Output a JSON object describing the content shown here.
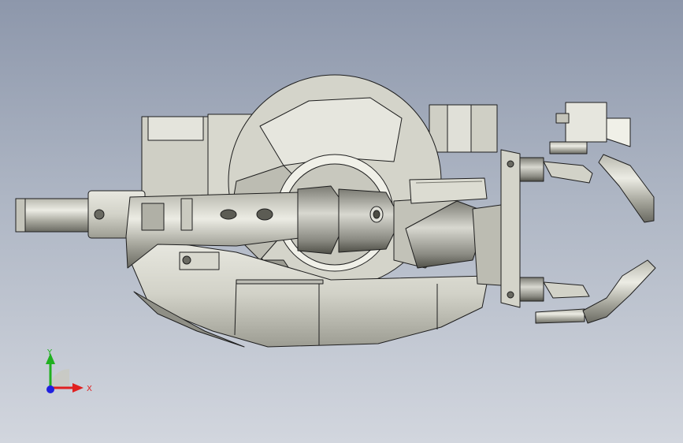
{
  "viewport": {
    "background_top": "#8d97ab",
    "background_bottom": "#d2d6de"
  },
  "model": {
    "body_color": "#d6d6cc",
    "shade_color": "#a8a89e",
    "edge_color": "#1e1e1e"
  },
  "triad": {
    "x_label": "X",
    "y_label": "Y",
    "x_color": "#e02020",
    "y_color": "#20b020",
    "z_color": "#2020e0"
  }
}
